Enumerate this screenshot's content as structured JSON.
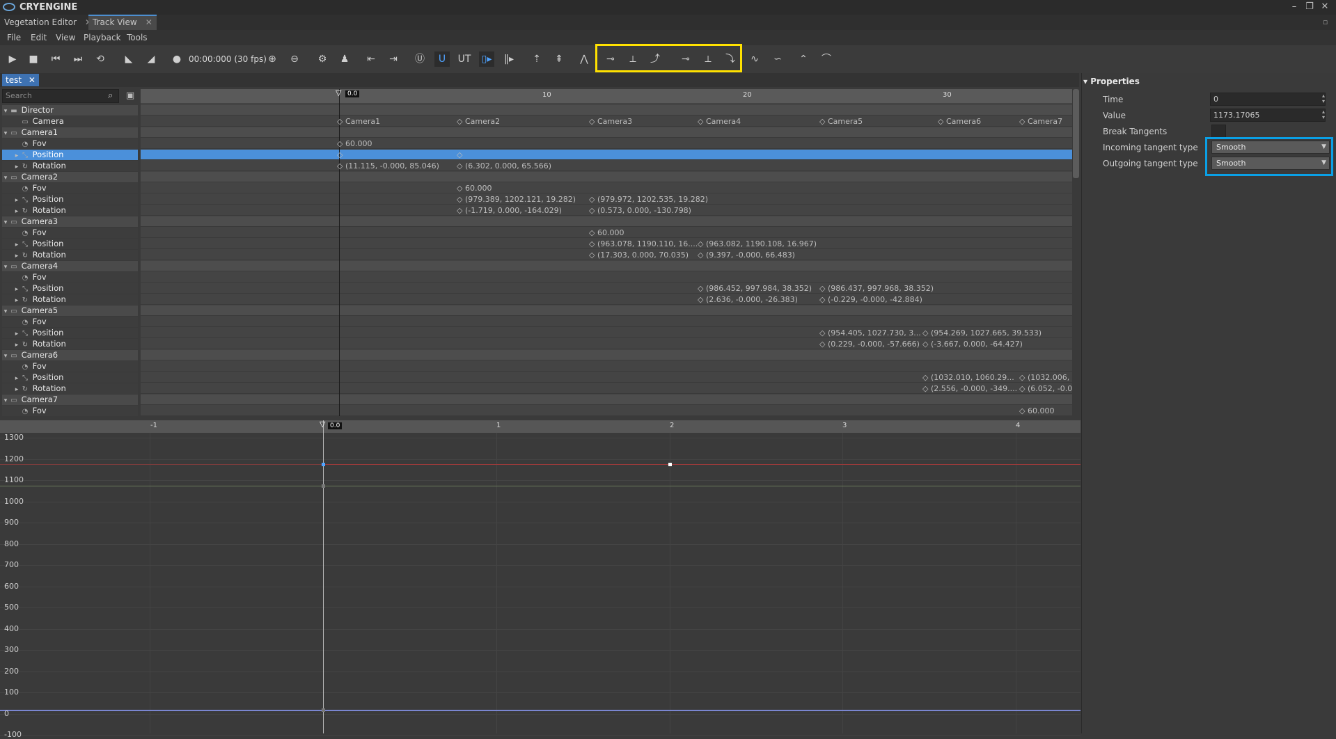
{
  "window": {
    "title": "CRYENGINE",
    "minimize": "–",
    "maximize": "❐",
    "close": "✕"
  },
  "tabs": [
    {
      "label": "Vegetation Editor",
      "close": "✕"
    },
    {
      "label": "Track View",
      "close": "✕"
    }
  ],
  "menu": [
    "File",
    "Edit",
    "View",
    "Playback",
    "Tools"
  ],
  "toolbar": {
    "timecode": "00:00:000 (30 fps)"
  },
  "sequence_tab": {
    "label": "test",
    "close": "✕"
  },
  "search": {
    "placeholder": "Search"
  },
  "tracks": [
    {
      "label": "Director",
      "type": "group",
      "icon": "director-icon"
    },
    {
      "label": "Camera",
      "type": "child",
      "icon": "camera-icon"
    },
    {
      "label": "Camera1",
      "type": "group",
      "icon": "camera-icon"
    },
    {
      "label": "Fov",
      "type": "child",
      "icon": "fov-icon"
    },
    {
      "label": "Position",
      "type": "child",
      "icon": "position-icon",
      "selected": true
    },
    {
      "label": "Rotation",
      "type": "child",
      "icon": "rotation-icon"
    },
    {
      "label": "Camera2",
      "type": "group",
      "icon": "camera-icon"
    },
    {
      "label": "Fov",
      "type": "child",
      "icon": "fov-icon"
    },
    {
      "label": "Position",
      "type": "child",
      "icon": "position-icon"
    },
    {
      "label": "Rotation",
      "type": "child",
      "icon": "rotation-icon"
    },
    {
      "label": "Camera3",
      "type": "group",
      "icon": "camera-icon"
    },
    {
      "label": "Fov",
      "type": "child",
      "icon": "fov-icon"
    },
    {
      "label": "Position",
      "type": "child",
      "icon": "position-icon"
    },
    {
      "label": "Rotation",
      "type": "child",
      "icon": "rotation-icon"
    },
    {
      "label": "Camera4",
      "type": "group",
      "icon": "camera-icon"
    },
    {
      "label": "Fov",
      "type": "child",
      "icon": "fov-icon"
    },
    {
      "label": "Position",
      "type": "child",
      "icon": "position-icon"
    },
    {
      "label": "Rotation",
      "type": "child",
      "icon": "rotation-icon"
    },
    {
      "label": "Camera5",
      "type": "group",
      "icon": "camera-icon"
    },
    {
      "label": "Fov",
      "type": "child",
      "icon": "fov-icon"
    },
    {
      "label": "Position",
      "type": "child",
      "icon": "position-icon"
    },
    {
      "label": "Rotation",
      "type": "child",
      "icon": "rotation-icon"
    },
    {
      "label": "Camera6",
      "type": "group",
      "icon": "camera-icon"
    },
    {
      "label": "Fov",
      "type": "child",
      "icon": "fov-icon"
    },
    {
      "label": "Position",
      "type": "child",
      "icon": "position-icon"
    },
    {
      "label": "Rotation",
      "type": "child",
      "icon": "rotation-icon"
    },
    {
      "label": "Camera7",
      "type": "group",
      "icon": "camera-icon"
    },
    {
      "label": "Fov",
      "type": "child",
      "icon": "fov-icon"
    }
  ],
  "dope_ruler": {
    "cursor": "0.0",
    "ticks": [
      "10",
      "20",
      "30"
    ]
  },
  "keys": {
    "camera": [
      "Camera1",
      "Camera2",
      "Camera3",
      "Camera4",
      "Camera5",
      "Camera6",
      "Camera7"
    ],
    "c1_fov": "60.000",
    "c1_rot": [
      "(11.115, -0.000, 85.046)",
      "(6.302, 0.000, 65.566)"
    ],
    "c2_fov": "60.000",
    "c2_pos": [
      "(979.389, 1202.121, 19.282)",
      "(979.972, 1202.535, 19.282)"
    ],
    "c2_rot": [
      "(-1.719, 0.000, -164.029)",
      "(0.573, 0.000, -130.798)"
    ],
    "c3_fov": "60.000",
    "c3_pos": [
      "(963.078, 1190.110, 16....",
      "(963.082, 1190.108, 16.967)"
    ],
    "c3_rot": [
      "(17.303, 0.000, 70.035)",
      "(9.397, -0.000, 66.483)"
    ],
    "c4_pos": [
      "(986.452, 997.984, 38.352)",
      "(986.437, 997.968, 38.352)"
    ],
    "c4_rot": [
      "(2.636, -0.000, -26.383)",
      "(-0.229, -0.000, -42.884)"
    ],
    "c5_pos": [
      "(954.405, 1027.730, 3...",
      "(954.269, 1027.665, 39.533)"
    ],
    "c5_rot": [
      "(0.229, -0.000, -57.666)",
      "(-3.667, 0.000, -64.427)"
    ],
    "c6_pos": [
      "(1032.010, 1060.29...",
      "(1032.006,"
    ],
    "c6_rot": [
      "(2.556, -0.000, -349....",
      "(6.052, -0.0"
    ],
    "c7_fov": "60.000"
  },
  "curve_ruler": {
    "cursor": "0.0",
    "ticks": [
      "-1",
      "1",
      "2",
      "3",
      "4"
    ]
  },
  "curve_y_labels": [
    "1300",
    "1200",
    "1100",
    "1000",
    "900",
    "800",
    "700",
    "600",
    "500",
    "400",
    "300",
    "200",
    "100",
    "0",
    "-100"
  ],
  "properties": {
    "title": "Properties",
    "time_label": "Time",
    "time_value": "0",
    "value_label": "Value",
    "value_value": "1173.17065",
    "break_label": "Break Tangents",
    "incoming_label": "Incoming tangent type",
    "incoming_value": "Smooth",
    "outgoing_label": "Outgoing tangent type",
    "outgoing_value": "Smooth"
  },
  "colors": {
    "accent": "#4b90da",
    "highlight_yellow": "#ffe100",
    "highlight_blue": "#0aa0e6"
  }
}
